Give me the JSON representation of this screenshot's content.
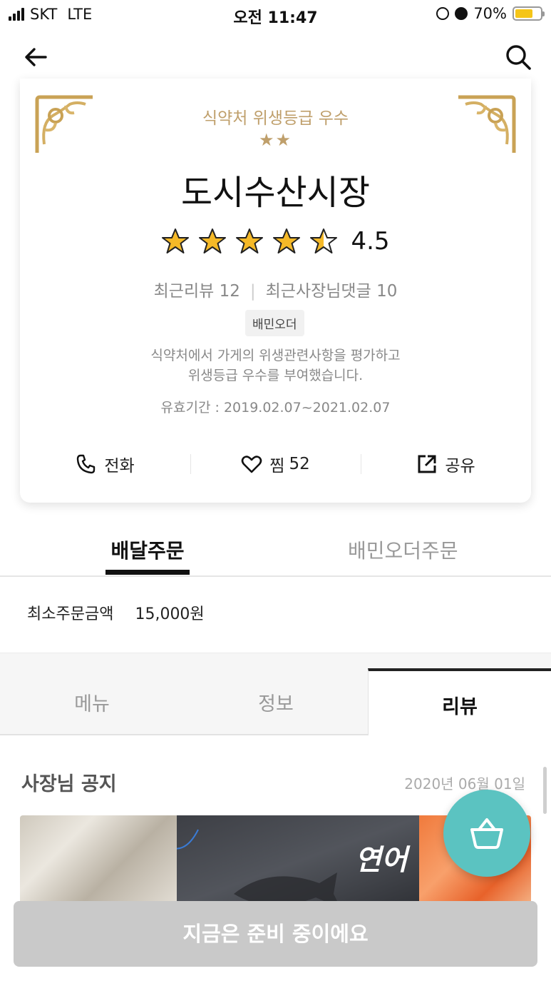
{
  "status_bar": {
    "carrier": "SKT",
    "network": "LTE",
    "time": "오전 11:47",
    "battery": "70%",
    "battery_level": 0.7
  },
  "nav": {
    "back_icon": "arrow-left-icon",
    "search_icon": "search-icon"
  },
  "store": {
    "hygiene_grade": "식약처 위생등급 우수",
    "hygiene_stars": "★★",
    "name": "도시수산시장",
    "rating": "4.5",
    "rating_value": 4.5,
    "recent_reviews_label": "최근리뷰",
    "recent_reviews_count": "12",
    "owner_replies_label": "최근사장님댓글",
    "owner_replies_count": "10",
    "badge": "배민오더",
    "description_line1": "식약처에서 가게의 위생관련사항을 평가하고",
    "description_line2": "위생등급 우수를 부여했습니다.",
    "validity": "유효기간 : 2019.02.07~2021.02.07",
    "accent_color": "#bf9f6b"
  },
  "actions": {
    "call_label": "전화",
    "like_label": "찜",
    "like_count": "52",
    "share_label": "공유"
  },
  "order_tabs": {
    "delivery": "배달주문",
    "baemin_order": "배민오더주문"
  },
  "min_order": {
    "label": "최소주문금액",
    "value": "15,000원"
  },
  "sub_tabs": {
    "menu": "메뉴",
    "info": "정보",
    "review": "리뷰"
  },
  "notice": {
    "title": "사장님 공지",
    "date": "2020년 06월 01일",
    "image_text": "연어"
  },
  "cart": {
    "icon": "basket-icon",
    "color": "#5bc3c1"
  },
  "cta": {
    "label": "지금은 준비 중이에요"
  }
}
